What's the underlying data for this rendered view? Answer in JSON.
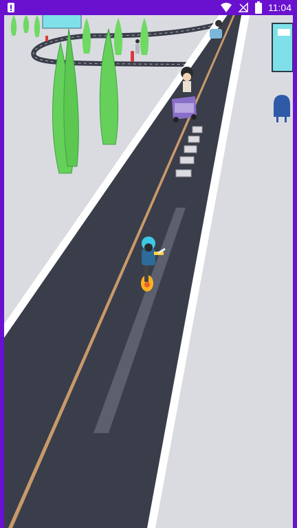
{
  "status_bar": {
    "time": "11:04",
    "alert_icon": "alert-icon",
    "wifi_icon": "wifi-icon",
    "signal_icon": "cell-signal-off-icon",
    "battery_icon": "battery-icon"
  },
  "scene": {
    "description_icons": [
      "road",
      "player-scooter",
      "car",
      "hydrant",
      "trees",
      "mailbox",
      "building"
    ],
    "colors": {
      "status_bar": "#6a11cf",
      "road": "#3a3d4a",
      "ground": "#d9dbe0",
      "centerline": "#c89a6a",
      "lane_stripe": "#5b5f6e",
      "player_helmet": "#3fc8e6",
      "tree": "#66d15a"
    }
  }
}
